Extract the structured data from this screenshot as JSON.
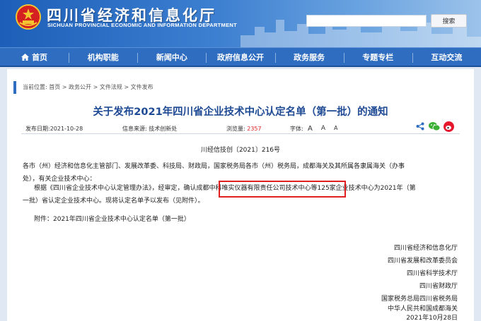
{
  "header": {
    "site_title": "四川省经济和信息化厅",
    "site_subtitle": "SICHUAN PROVINCIAL ECONOMIC AND INFORMATION DEPARTMENT",
    "search_placeholder": "",
    "search_button": "搜索"
  },
  "nav": {
    "items": [
      "首页",
      "机构职能",
      "新闻中心",
      "政府信息公开",
      "政务服务",
      "专题专栏",
      "互动交流"
    ]
  },
  "breadcrumb": "当前位置: 首页 > 政务公开 > 文件法规 > 文件发布",
  "article": {
    "title": "关于发布2021年四川省企业技术中心认定名单（第一批）的通知",
    "publish_label": "发布日期:",
    "publish_date": "2021-10-28",
    "source_label": "信息来源:",
    "source": "技术创新处",
    "views_label": "浏览量:",
    "views": "2357",
    "font_label": "字体:",
    "font_sizes": [
      "A",
      "A",
      "A"
    ],
    "doc_number": "川经信技创〔2021〕216号",
    "para1_line1": "各市（州）经济和信息化主管部门、发展改革委、科技局、财政局，国家税务局各市（州）税务局，成都海关及其所属各隶属海关（办事",
    "para1_line2": "处），有关企业技术中心：",
    "para2_line1": "根据《四川省企业技术中心认定管理办法》，经审定，确认成都中科唯实仪器有限责任公司技术中心等125家企业技术中心为2021年（第",
    "para2_line2": "一批）省认定企业技术中心。现将认定名单予以发布（见附件）。",
    "attachment": "附件：2021年四川省企业技术中心认定名单（第一批）",
    "signatures": [
      "四川省经济和信息化厅",
      "四川省发展和改革委员会",
      "四川省科学技术厅",
      "四川省财政厅",
      "国家税务总局四川省税务局",
      "中华人民共和国成都海关"
    ],
    "sign_date": "2021年10月28日"
  },
  "colors": {
    "brand_blue": "#2f6dc1",
    "title_blue": "#1f4a94",
    "highlight_red": "#e02020"
  }
}
